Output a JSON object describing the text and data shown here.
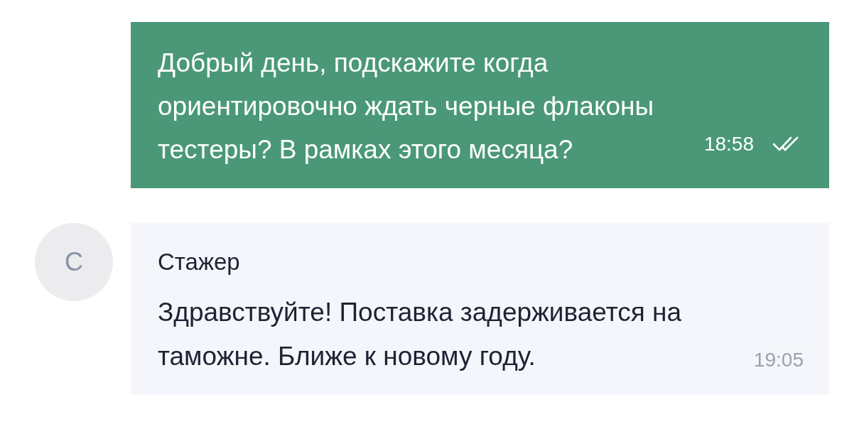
{
  "messages": [
    {
      "kind": "outgoing",
      "text": "Добрый день, подскажите когда ориентировочно ждать черные флаконы тестеры? В рамках этого месяца?",
      "time": "18:58",
      "read": true
    },
    {
      "kind": "incoming",
      "avatar_letter": "С",
      "sender": "Стажер",
      "text": "Здравствуйте! Поставка задерживается на таможне. Ближе к новому году.",
      "time": "19:05"
    }
  ]
}
